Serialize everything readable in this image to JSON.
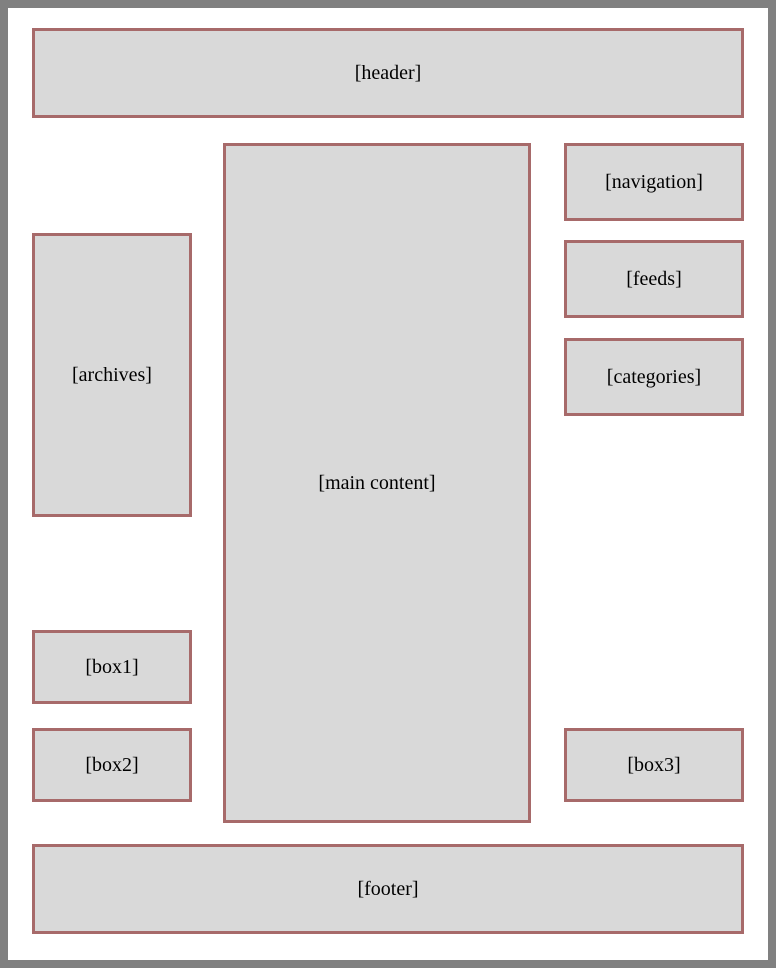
{
  "layout": {
    "header": "[header]",
    "navigation": "[navigation]",
    "feeds": "[feeds]",
    "categories": "[categories]",
    "archives": "[archives]",
    "main_content": "[main content]",
    "box1": "[box1]",
    "box2": "[box2]",
    "box3": "[box3]",
    "footer": "[footer]"
  }
}
